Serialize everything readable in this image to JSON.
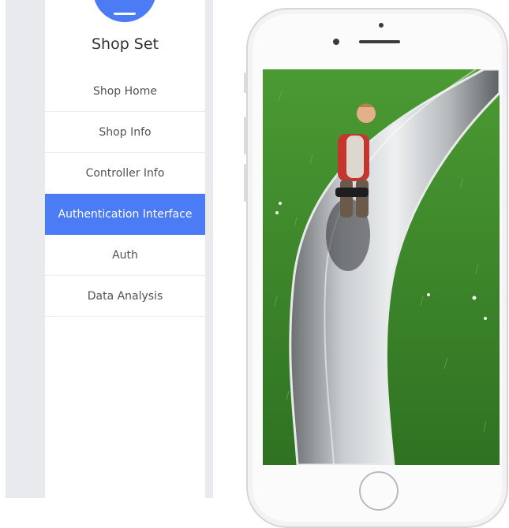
{
  "sidebar": {
    "title": "Shop Set",
    "items": [
      {
        "label": "Shop Home",
        "active": false
      },
      {
        "label": "Shop Info",
        "active": false
      },
      {
        "label": "Controller Info",
        "active": false
      },
      {
        "label": "Authentication Interface",
        "active": true
      },
      {
        "label": "Auth",
        "active": false
      },
      {
        "label": "Data Analysis",
        "active": false
      }
    ]
  },
  "colors": {
    "accent": "#4b7bf5",
    "panel_gray": "#e8eaed"
  },
  "preview": {
    "icons": [
      "camera-icon",
      "speaker-icon",
      "home-button-icon"
    ]
  }
}
